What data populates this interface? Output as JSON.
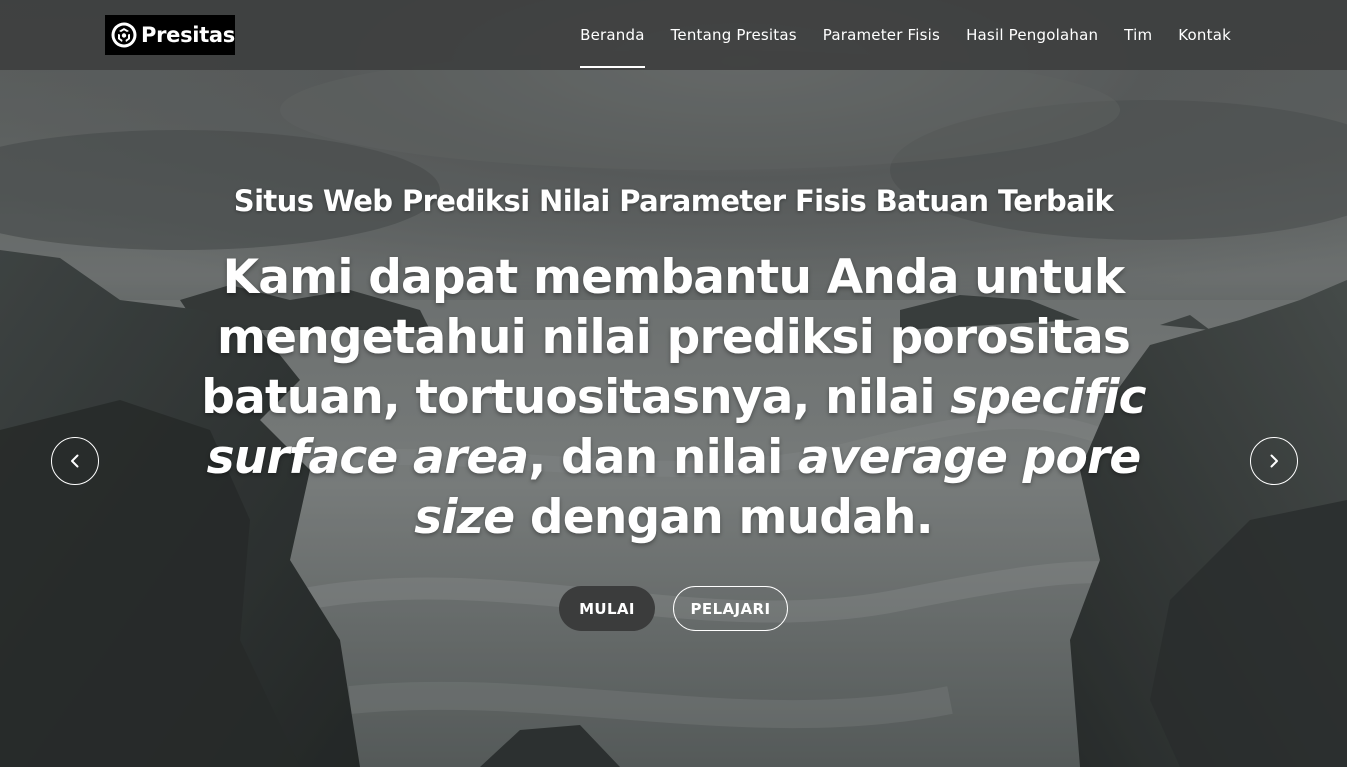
{
  "brand": {
    "name": "Presitas",
    "logo_icon": "recycle-circle-icon"
  },
  "nav": {
    "items": [
      {
        "label": "Beranda",
        "active": true
      },
      {
        "label": "Tentang Presitas",
        "active": false
      },
      {
        "label": "Parameter Fisis",
        "active": false
      },
      {
        "label": "Hasil Pengolahan",
        "active": false
      },
      {
        "label": "Tim",
        "active": false
      },
      {
        "label": "Kontak",
        "active": false
      }
    ]
  },
  "hero": {
    "subtitle": "Situs Web Prediksi Nilai Parameter Fisis Batuan Terbaik",
    "title_parts": [
      {
        "text": "Kami dapat membantu Anda untuk mengetahui nilai prediksi porositas batuan, tortuositasnya, nilai ",
        "italic": false
      },
      {
        "text": "specific surface area",
        "italic": true
      },
      {
        "text": ", dan nilai ",
        "italic": false
      },
      {
        "text": "average pore size",
        "italic": true
      },
      {
        "text": " dengan mudah.",
        "italic": false
      }
    ],
    "primary_button": "MULAI",
    "secondary_button": "PELAJARI"
  },
  "carousel": {
    "prev_icon": "chevron-left-icon",
    "next_icon": "chevron-right-icon"
  },
  "colors": {
    "header_bg": "#3c3e3e",
    "primary_button_bg": "#3b3c3c",
    "text": "#ffffff"
  }
}
